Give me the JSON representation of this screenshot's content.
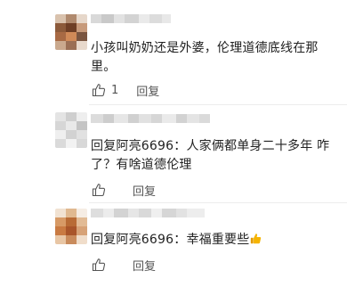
{
  "comments": [
    {
      "text": "小孩叫奶奶还是外婆，伦理道德底线在那里。",
      "like_count": "1",
      "reply_label": "回复"
    },
    {
      "reply_prefix": "回复",
      "reply_target": "阿亮6696",
      "text": "：人家俩都单身二十多年 咋了？有啥道德伦理",
      "like_count": "",
      "reply_label": "回复"
    },
    {
      "reply_prefix": "回复",
      "reply_target": "阿亮6696",
      "text": "：幸福重要些",
      "emoji": "thumbs-up-emoji",
      "like_count": "",
      "reply_label": "回复"
    }
  ],
  "icons": {
    "like": "thumbs-up-outline-icon"
  },
  "colors": {
    "text": "#222222",
    "meta": "#555555",
    "divider": "#ececec",
    "emoji": "#f5b400"
  }
}
